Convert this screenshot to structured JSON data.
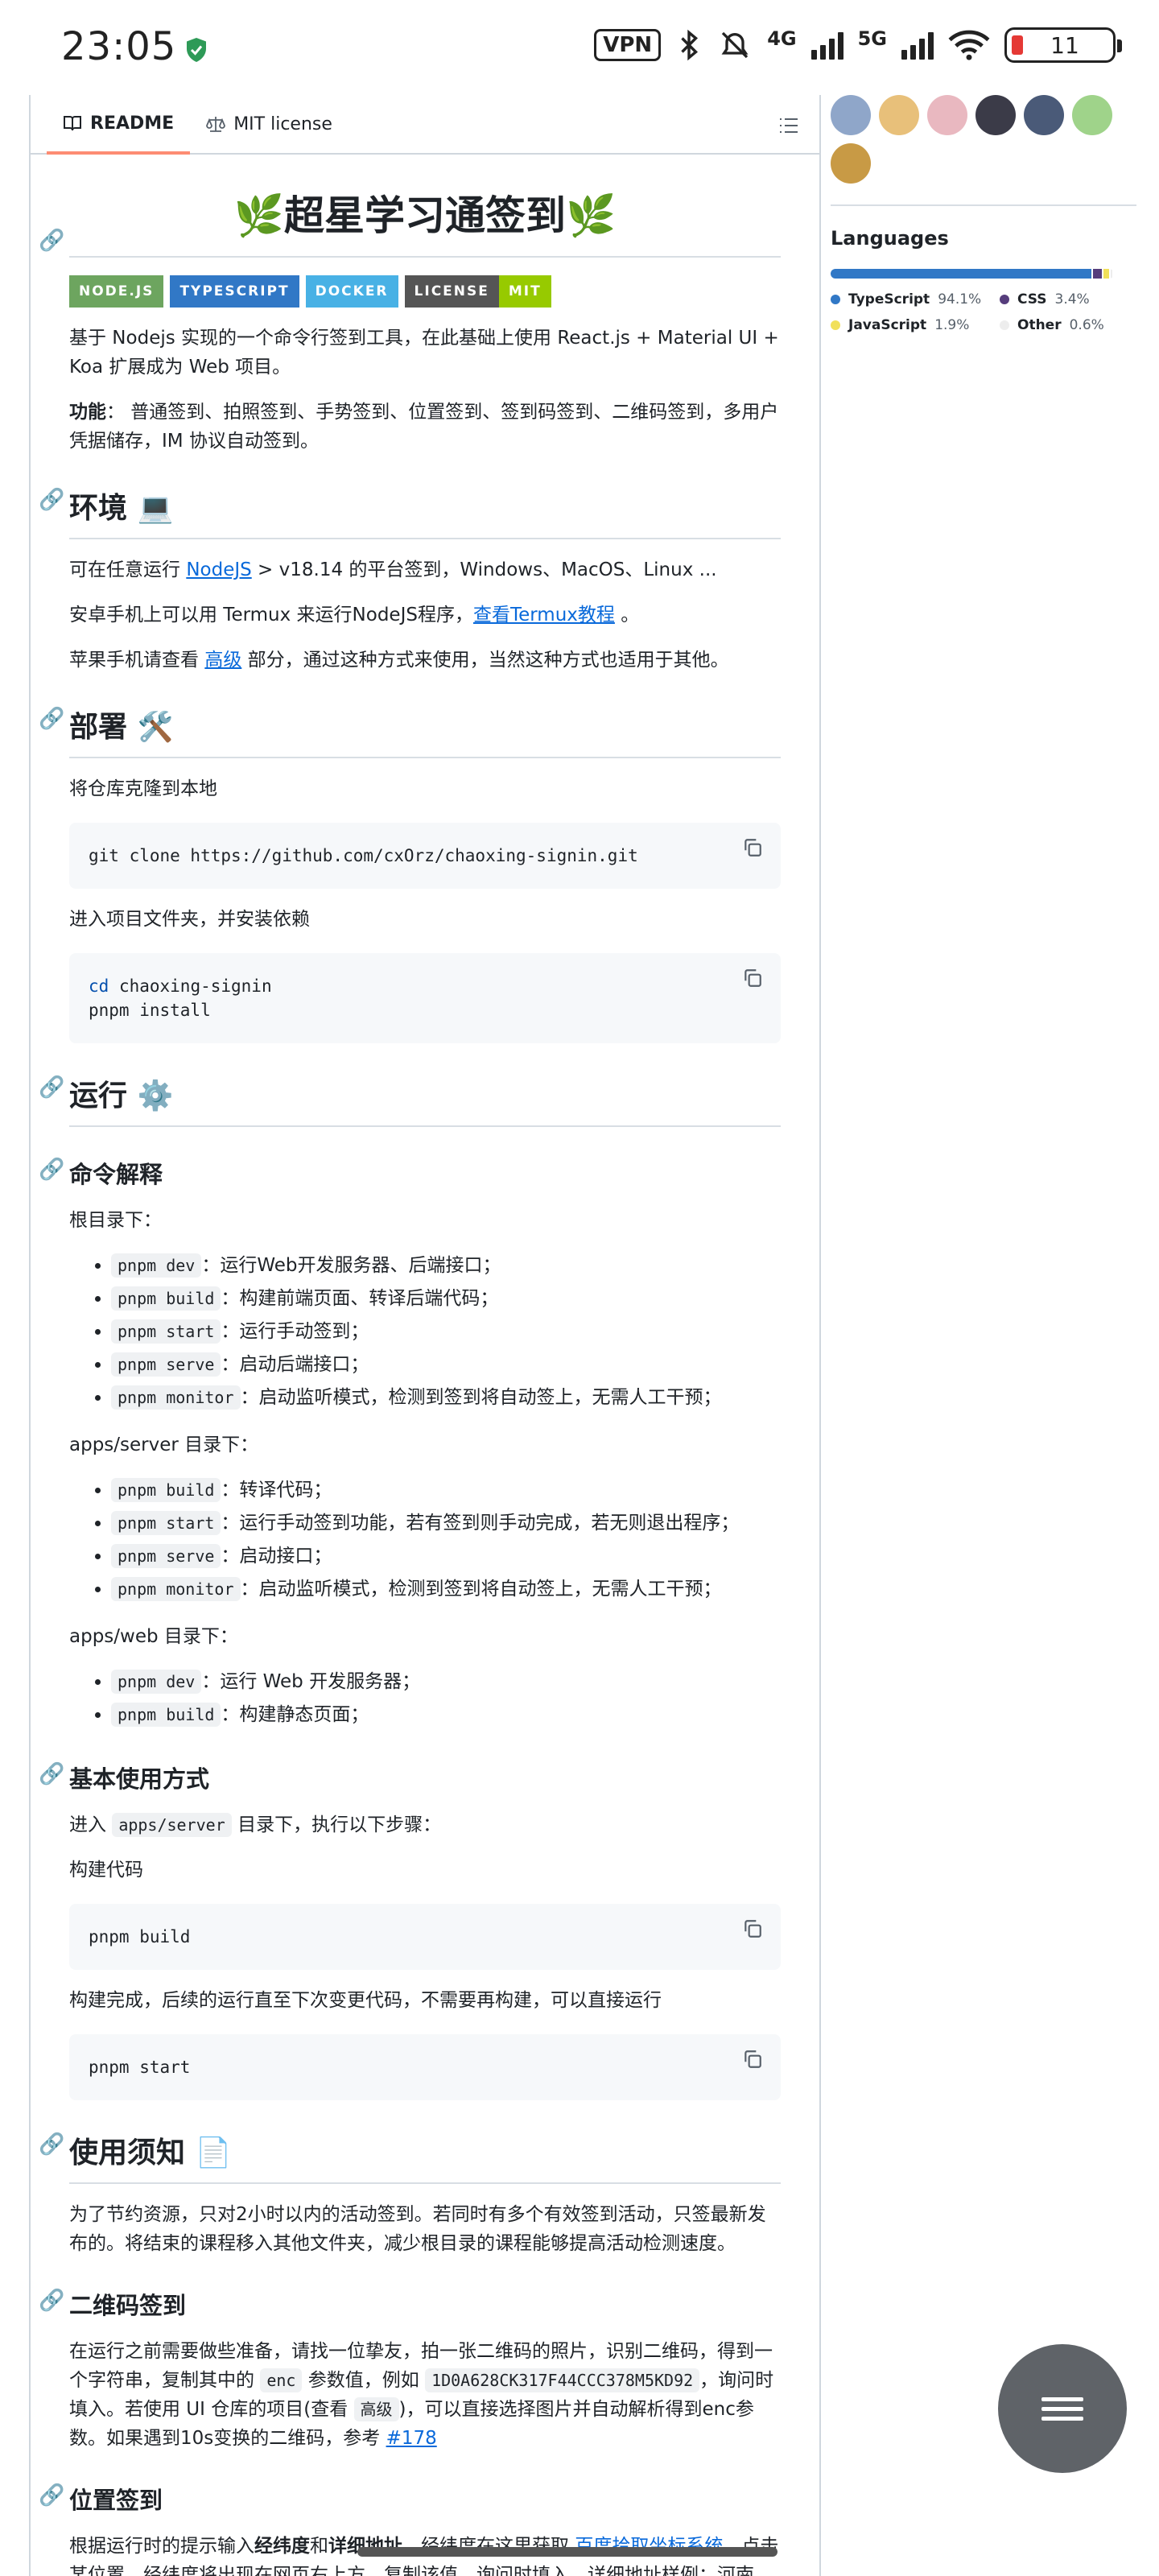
{
  "status_bar": {
    "time": "23:05",
    "vpn": "VPN",
    "net1": "4G",
    "net2": "5G",
    "battery": "11"
  },
  "tabs": [
    {
      "label": "README"
    },
    {
      "label": "MIT license"
    }
  ],
  "readme": {
    "title": "🌿超星学习通签到🌿",
    "badges": [
      {
        "left": "NODE.JS",
        "color": "#6da55f",
        "text_color": "#fff"
      },
      {
        "left": "TYPESCRIPT",
        "color": "#3178c6",
        "text_color": "#fff"
      },
      {
        "left": "DOCKER",
        "color": "#48b1e5",
        "text_color": "#fff"
      },
      {
        "left": "LICENSE",
        "right": "MIT",
        "color": "#555555",
        "right_color": "#97ca00",
        "text_color": "#fff"
      }
    ],
    "intro": "基于 Nodejs 实现的一个命令行签到工具，在此基础上使用 React.js + Material UI + Koa 扩展成为 Web 项目。",
    "features_label": "功能",
    "features_text": "： 普通签到、拍照签到、手势签到、位置签到、签到码签到、二维码签到，多用户凭据储存，IM 协议自动签到。",
    "env": {
      "heading": "环境 💻",
      "p1_a": "可在任意运行 ",
      "p1_link": "NodeJS",
      "p1_b": " > v18.14 的平台签到，Windows、MacOS、Linux ...",
      "p2_a": "安卓手机上可以用 Termux 来运行NodeJS程序，",
      "p2_link": "查看Termux教程",
      "p2_b": " 。",
      "p3_a": "苹果手机请查看 ",
      "p3_link": "高级",
      "p3_b": " 部分，通过这种方式来使用，当然这种方式也适用于其他。"
    },
    "deploy": {
      "heading": "部署 🛠️",
      "p1": "将仓库克隆到本地",
      "code1": "git clone https://github.com/cxOrz/chaoxing-signin.git",
      "p2": "进入项目文件夹，并安装依赖",
      "code2_kw": "cd",
      "code2_rest": " chaoxing-signin",
      "code2_line2": "pnpm install"
    },
    "run": {
      "heading": "运行 ⚙️"
    },
    "commands": {
      "heading": "命令解释",
      "root_label": "根目录下：",
      "root": [
        {
          "code": "pnpm dev",
          "text": "：运行Web开发服务器、后端接口；"
        },
        {
          "code": "pnpm build",
          "text": "：构建前端页面、转译后端代码；"
        },
        {
          "code": "pnpm start",
          "text": "：运行手动签到；"
        },
        {
          "code": "pnpm serve",
          "text": "：启动后端接口；"
        },
        {
          "code": "pnpm monitor",
          "text": "：启动监听模式，检测到签到将自动签上，无需人工干预；"
        }
      ],
      "server_label": "apps/server 目录下：",
      "server": [
        {
          "code": "pnpm build",
          "text": "：转译代码；"
        },
        {
          "code": "pnpm start",
          "text": "：运行手动签到功能，若有签到则手动完成，若无则退出程序；"
        },
        {
          "code": "pnpm serve",
          "text": "：启动接口；"
        },
        {
          "code": "pnpm monitor",
          "text": "：启动监听模式，检测到签到将自动签上，无需人工干预；"
        }
      ],
      "web_label": "apps/web 目录下：",
      "web": [
        {
          "code": "pnpm dev",
          "text": "：运行 Web 开发服务器；"
        },
        {
          "code": "pnpm build",
          "text": "：构建静态页面；"
        }
      ]
    },
    "basic": {
      "heading": "基本使用方式",
      "p1_a": "进入 ",
      "p1_code": "apps/server",
      "p1_b": " 目录下，执行以下步骤：",
      "p2": "构建代码",
      "code1": "pnpm build",
      "p3": "构建完成，后续的运行直至下次变更代码，不需要再构建，可以直接运行",
      "code2": "pnpm start"
    },
    "notice": {
      "heading": "使用须知 📄",
      "p1": "为了节约资源，只对2小时以内的活动签到。若同时有多个有效签到活动，只签最新发布的。将结束的课程移入其他文件夹，减少根目录的课程能够提高活动检测速度。"
    },
    "qr": {
      "heading": "二维码签到",
      "p_a": "在运行之前需要做些准备，请找一位挚友，拍一张二维码的照片，识别二维码，得到一个字符串，复制其中的 ",
      "code_enc": "enc",
      "p_b": " 参数值，例如 ",
      "code_ex": "1D0A628CK317F44CCC378M5KD92",
      "p_c": "，询问时填入。若使用 UI 仓库的项目(查看 ",
      "code_adv": "高级",
      "p_d": ")，可以直接选择图片并自动解析得到enc参数。如果遇到10s变换的二维码，参考 ",
      "link": "#178"
    },
    "location": {
      "heading": "位置签到",
      "p_a": "根据运行时的提示输入",
      "bold1": "经纬度",
      "p_b": "和",
      "bold2": "详细地址",
      "p_c": "，经纬度在这里获取 ",
      "link": "百度拾取坐标系统",
      "p_d": "，点击某位置，经纬度将出现在网页右上方，复制该值，询问时填入。详细地址样例：河南"
    }
  },
  "sidebar": {
    "avatar_colors": [
      "#8fa6c9",
      "#e8c07a",
      "#e9b8c0",
      "#3b3b48",
      "#4a5a78",
      "#9fd38a",
      "#c89a45"
    ],
    "languages_title": "Languages",
    "languages": [
      {
        "name": "TypeScript",
        "pct": "94.1%",
        "value": 94.1,
        "color": "#3178c6"
      },
      {
        "name": "CSS",
        "pct": "3.4%",
        "value": 3.4,
        "color": "#563d7c"
      },
      {
        "name": "JavaScript",
        "pct": "1.9%",
        "value": 1.9,
        "color": "#f1e05a"
      },
      {
        "name": "Other",
        "pct": "0.6%",
        "value": 0.6,
        "color": "#ededed"
      }
    ]
  }
}
